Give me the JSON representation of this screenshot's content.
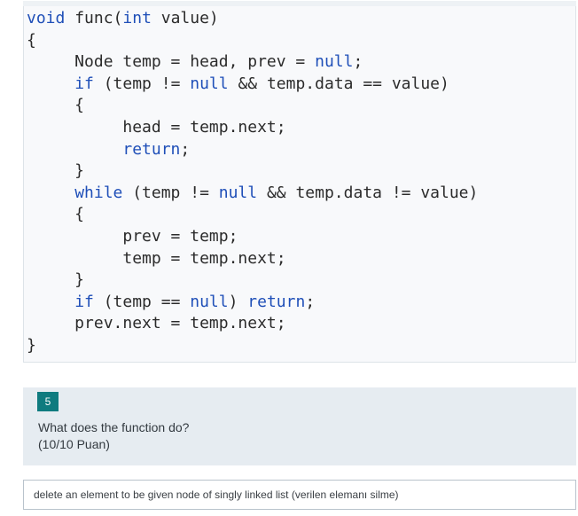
{
  "code": {
    "lines": [
      [
        {
          "t": "void",
          "k": true
        },
        {
          "t": " func(",
          "k": false
        },
        {
          "t": "int",
          "k": true
        },
        {
          "t": " value)",
          "k": false
        }
      ],
      [
        {
          "t": "{",
          "k": false
        }
      ],
      [
        {
          "t": "     Node temp = head, prev = ",
          "k": false
        },
        {
          "t": "null",
          "k": true
        },
        {
          "t": ";",
          "k": false
        }
      ],
      [
        {
          "t": "     ",
          "k": false
        },
        {
          "t": "if",
          "k": true
        },
        {
          "t": " (temp != ",
          "k": false
        },
        {
          "t": "null",
          "k": true
        },
        {
          "t": " && temp.data == value)",
          "k": false
        }
      ],
      [
        {
          "t": "     {",
          "k": false
        }
      ],
      [
        {
          "t": "          head = temp.next;",
          "k": false
        }
      ],
      [
        {
          "t": "          ",
          "k": false
        },
        {
          "t": "return",
          "k": true
        },
        {
          "t": ";",
          "k": false
        }
      ],
      [
        {
          "t": "     }",
          "k": false
        }
      ],
      [
        {
          "t": "     ",
          "k": false
        },
        {
          "t": "while",
          "k": true
        },
        {
          "t": " (temp != ",
          "k": false
        },
        {
          "t": "null",
          "k": true
        },
        {
          "t": " && temp.data != value)",
          "k": false
        }
      ],
      [
        {
          "t": "     {",
          "k": false
        }
      ],
      [
        {
          "t": "          prev = temp;",
          "k": false
        }
      ],
      [
        {
          "t": "          temp = temp.next;",
          "k": false
        }
      ],
      [
        {
          "t": "     }",
          "k": false
        }
      ],
      [
        {
          "t": "     ",
          "k": false
        },
        {
          "t": "if",
          "k": true
        },
        {
          "t": " (temp == ",
          "k": false
        },
        {
          "t": "null",
          "k": true
        },
        {
          "t": ") ",
          "k": false
        },
        {
          "t": "return",
          "k": true
        },
        {
          "t": ";",
          "k": false
        }
      ],
      [
        {
          "t": "     prev.next = temp.next;",
          "k": false
        }
      ],
      [
        {
          "t": "}",
          "k": false
        }
      ]
    ]
  },
  "question": {
    "number": "5",
    "text": "What does the function do?",
    "points": "(10/10 Puan)"
  },
  "answer": {
    "value": "delete an element to be given node of singly linked list (verilen elemanı silme)"
  },
  "colors": {
    "keyword": "#1f4fb8",
    "badge": "#0f7b7f",
    "question_bg": "#e6ecf1"
  }
}
